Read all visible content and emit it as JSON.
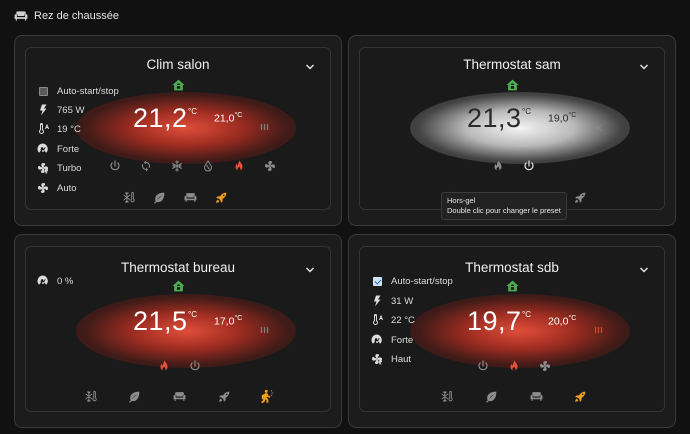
{
  "section": {
    "title": "Rez de chaussée",
    "icon": "sofa-icon"
  },
  "colors": {
    "heat": "#e8503a",
    "preset_active": "#f0a020",
    "home": "#4caf50",
    "icon_gray": "#8c8c8c"
  },
  "cards": {
    "salon": {
      "title": "Clim salon",
      "current_temp": "21,2",
      "unit": "°C",
      "target_temp": "21,0",
      "target_unit": "°C",
      "glow": "red",
      "attributes": {
        "autostart": "Auto-start/stop",
        "power": "765 W",
        "outdoor": "19 °C",
        "fan_force": "Forte",
        "turbo": "Turbo",
        "fan_mode": "Auto"
      },
      "modes": [
        "power-icon",
        "sync-icon",
        "snowflake-icon",
        "water-icon",
        "flame-icon",
        "fan-icon"
      ],
      "active_mode": "flame-icon",
      "presets": [
        "frost-protection-icon",
        "eco-leaf-icon",
        "comfort-sofa-icon",
        "boost-rocket-icon"
      ],
      "active_preset": "boost-rocket-icon"
    },
    "sam": {
      "title": "Thermostat sam",
      "current_temp": "21,3",
      "unit": "°C",
      "target_temp": "19,0",
      "target_unit": "°C",
      "glow": "white",
      "modes": [
        "flame-icon",
        "power-icon"
      ],
      "active_mode": "none",
      "presets": [
        "frost-protection-icon",
        "eco-leaf-icon",
        "comfort-sofa-icon",
        "boost-rocket-icon"
      ],
      "active_preset": "comfort-sofa-icon",
      "tooltip": {
        "line1": "Hors-gel",
        "line2": "Double clic pour changer le preset"
      }
    },
    "bureau": {
      "title": "Thermostat bureau",
      "current_temp": "21,5",
      "unit": "°C",
      "target_temp": "17,0",
      "target_unit": "°C",
      "glow": "red",
      "attributes": {
        "window": "0 %"
      },
      "modes": [
        "flame-icon",
        "power-icon"
      ],
      "active_mode": "flame-icon",
      "presets": [
        "frost-protection-icon",
        "eco-leaf-icon",
        "comfort-sofa-icon",
        "boost-rocket-icon",
        "presence-walk-icon"
      ],
      "active_preset": "presence-walk-icon"
    },
    "sdb": {
      "title": "Thermostat sdb",
      "current_temp": "19,7",
      "unit": "°C",
      "target_temp": "20,0",
      "target_unit": "°C",
      "glow": "red",
      "attributes": {
        "autostart": "Auto-start/stop",
        "power": "31 W",
        "outdoor": "22 °C",
        "fan_force": "Forte",
        "fan_mode": "Haut"
      },
      "modes": [
        "power-icon",
        "flame-icon",
        "fan-icon"
      ],
      "active_mode": "flame-icon",
      "presets": [
        "frost-protection-icon",
        "eco-leaf-icon",
        "comfort-sofa-icon",
        "boost-rocket-icon"
      ],
      "active_preset": "boost-rocket-icon"
    }
  }
}
